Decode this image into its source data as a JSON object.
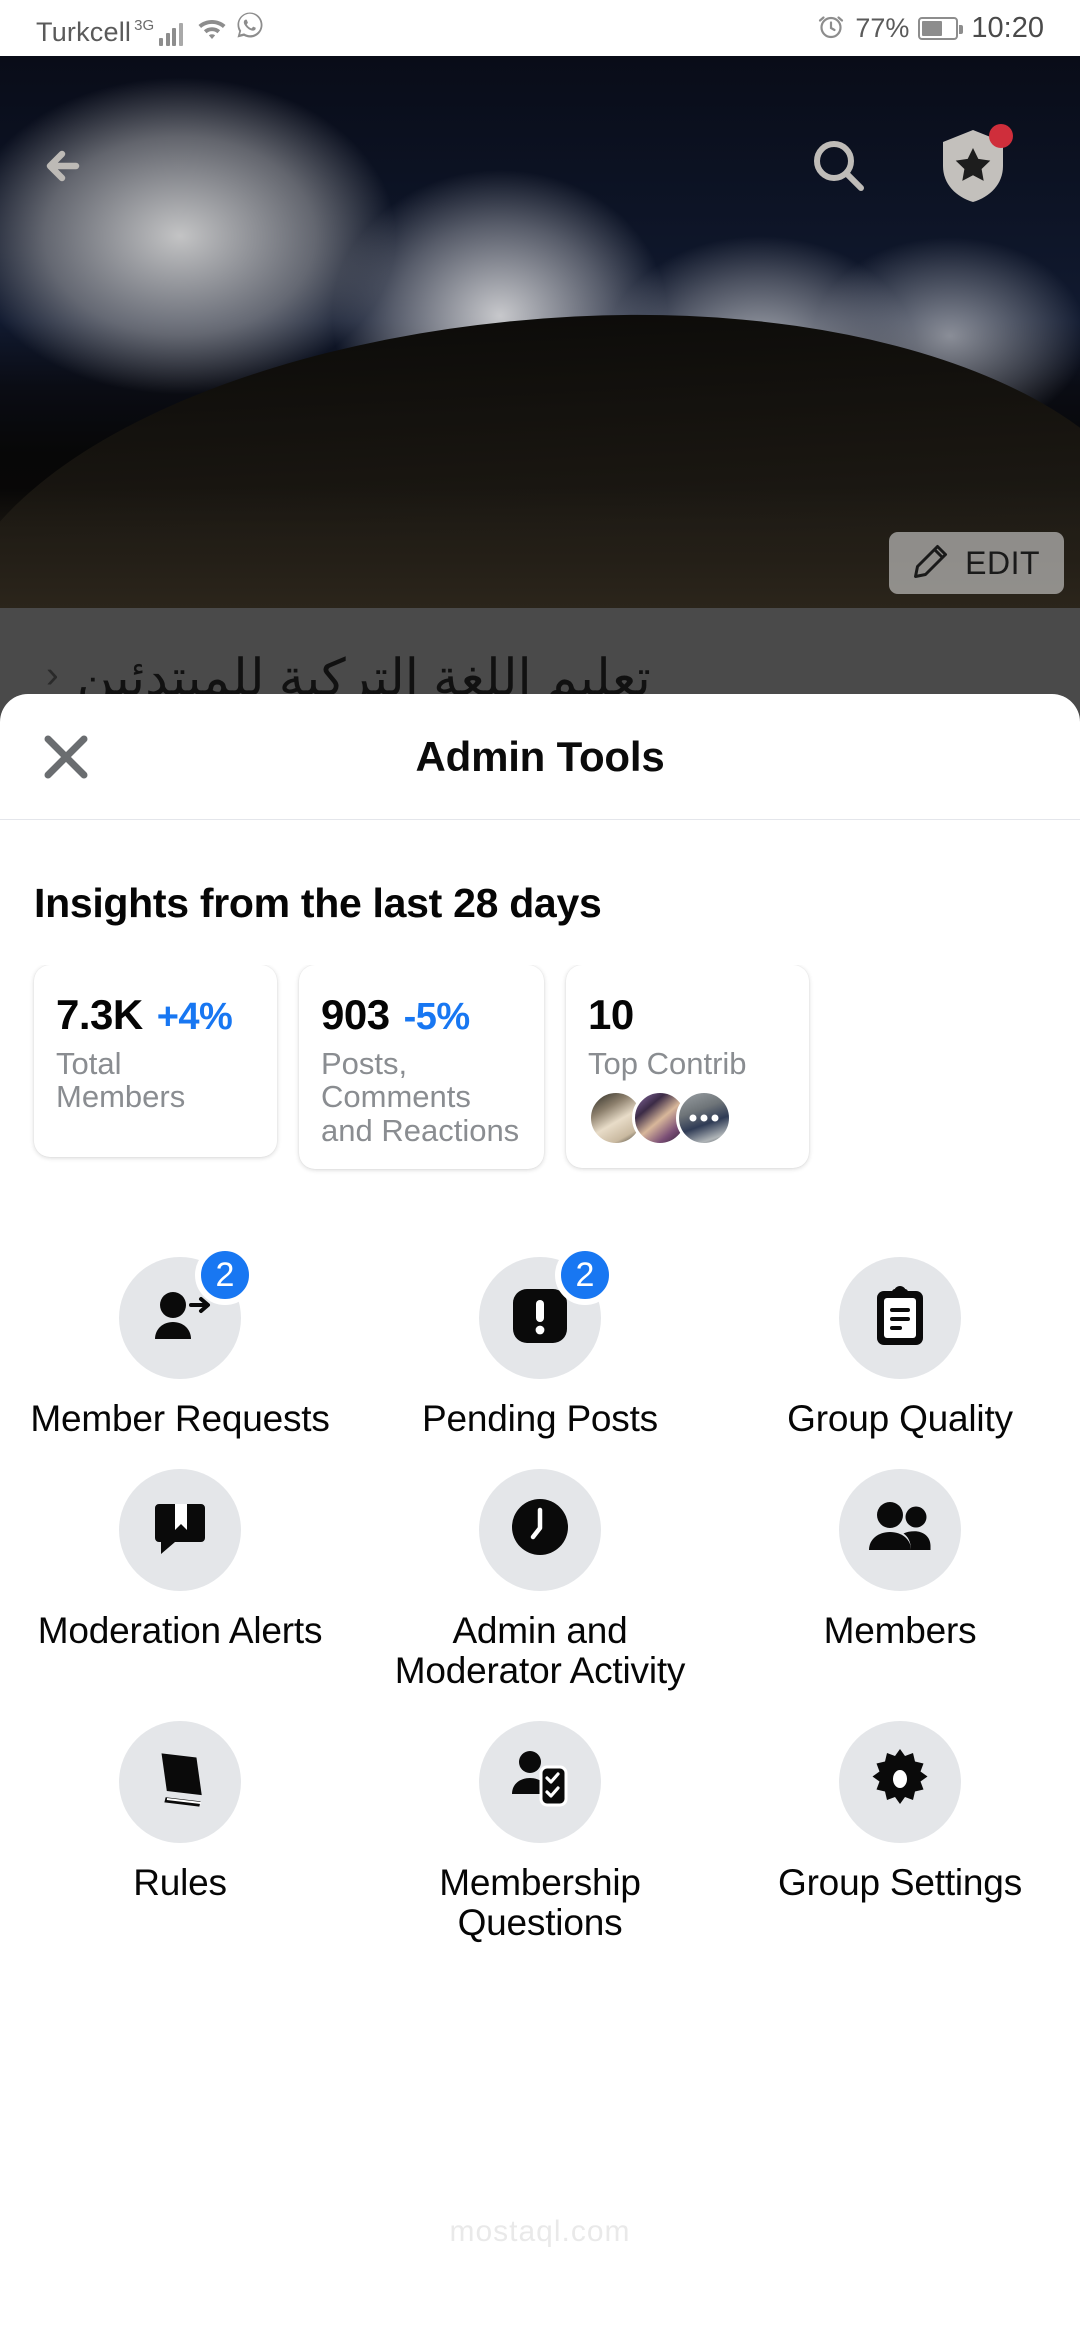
{
  "status_bar": {
    "carrier": "Turkcell",
    "network": "3G",
    "battery_percent": "77%",
    "time": "10:20",
    "icons": [
      "signal-bars-icon",
      "wifi-icon",
      "whatsapp-icon",
      "alarm-icon",
      "battery-icon"
    ]
  },
  "cover": {
    "back_icon": "back-arrow-icon",
    "search_icon": "search-icon",
    "shield_icon": "shield-star-icon",
    "has_notification_dot": true,
    "edit_label": "EDIT",
    "edit_icon": "pencil-icon"
  },
  "group": {
    "name": "تعليم اللغة التركية للمبتدئين",
    "chevron": "‹"
  },
  "sheet": {
    "title": "Admin Tools",
    "close_icon": "close-x-icon",
    "insights_heading": "Insights from the last 28 days"
  },
  "insights": [
    {
      "value": "7.3K",
      "delta": "+4%",
      "label": "Total Members",
      "delta_color": "#1877f2"
    },
    {
      "value": "903",
      "delta": "-5%",
      "label": "Posts, Comments and Reactions",
      "delta_color": "#1877f2"
    },
    {
      "value": "10",
      "delta": "",
      "label": "Top Contrib",
      "avatars": 3
    }
  ],
  "tools": [
    {
      "label": "Member Requests",
      "icon": "person-add-icon",
      "badge": "2"
    },
    {
      "label": "Pending Posts",
      "icon": "exclamation-square-icon",
      "badge": "2"
    },
    {
      "label": "Group Quality",
      "icon": "clipboard-icon",
      "badge": ""
    },
    {
      "label": "Moderation Alerts",
      "icon": "bookmark-bubble-icon",
      "badge": ""
    },
    {
      "label": "Admin and Moderator Activity",
      "icon": "clock-icon",
      "badge": ""
    },
    {
      "label": "Members",
      "icon": "people-icon",
      "badge": ""
    },
    {
      "label": "Rules",
      "icon": "book-icon",
      "badge": ""
    },
    {
      "label": "Membership Questions",
      "icon": "person-checklist-icon",
      "badge": ""
    },
    {
      "label": "Group Settings",
      "icon": "gear-icon",
      "badge": ""
    }
  ],
  "watermark": "mostaql.com",
  "colors": {
    "accent_blue": "#1877f2",
    "icon_bg": "#e4e6e9",
    "text_primary": "#060606",
    "text_secondary": "#8a8d91",
    "notification_red": "#cf2e3b"
  }
}
